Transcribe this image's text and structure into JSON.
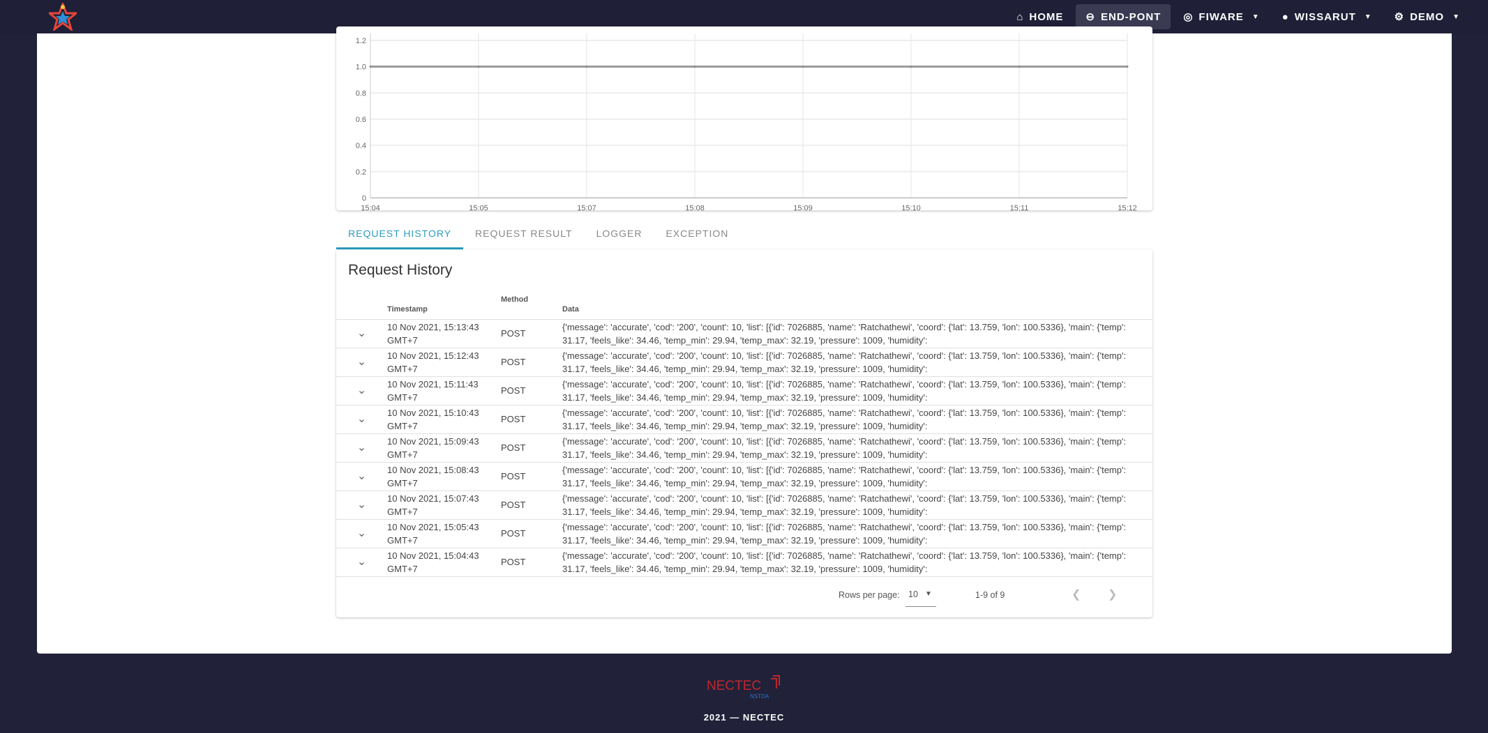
{
  "nav": {
    "items": [
      {
        "label": "HOME",
        "icon": "home-icon"
      },
      {
        "label": "END-PONT",
        "icon": "link-icon",
        "active": true
      },
      {
        "label": "FIWARE",
        "icon": "fingerprint-icon",
        "dropdown": true
      },
      {
        "label": "WISSARUT",
        "icon": "user-icon",
        "dropdown": true
      },
      {
        "label": "DEMO",
        "icon": "gears-icon",
        "dropdown": true
      }
    ]
  },
  "chart_data": {
    "type": "line",
    "x": [
      "15:04",
      "15:05",
      "15:07",
      "15:08",
      "15:09",
      "15:10",
      "15:11",
      "15:12"
    ],
    "series": [
      {
        "values": [
          1,
          1,
          1,
          1,
          1,
          1,
          1,
          1
        ]
      }
    ],
    "yticks": [
      "0",
      "0.2",
      "0.4",
      "0.6",
      "0.8",
      "1.0",
      "1.2"
    ],
    "ylim": [
      0,
      1.2
    ],
    "grid": true
  },
  "tabs": [
    {
      "label": "REQUEST HISTORY",
      "active": true
    },
    {
      "label": "REQUEST RESULT"
    },
    {
      "label": "LOGGER"
    },
    {
      "label": "EXCEPTION"
    }
  ],
  "table": {
    "title": "Request History",
    "headers": [
      "Timestamp",
      "Method",
      "Data"
    ],
    "rows": [
      {
        "ts": "10 Nov 2021, 15:13:43 GMT+7",
        "method": "POST"
      },
      {
        "ts": "10 Nov 2021, 15:12:43 GMT+7",
        "method": "POST"
      },
      {
        "ts": "10 Nov 2021, 15:11:43 GMT+7",
        "method": "POST"
      },
      {
        "ts": "10 Nov 2021, 15:10:43 GMT+7",
        "method": "POST"
      },
      {
        "ts": "10 Nov 2021, 15:09:43 GMT+7",
        "method": "POST"
      },
      {
        "ts": "10 Nov 2021, 15:08:43 GMT+7",
        "method": "POST"
      },
      {
        "ts": "10 Nov 2021, 15:07:43 GMT+7",
        "method": "POST"
      },
      {
        "ts": "10 Nov 2021, 15:05:43 GMT+7",
        "method": "POST"
      },
      {
        "ts": "10 Nov 2021, 15:04:43 GMT+7",
        "method": "POST"
      }
    ],
    "data_text": "{'message': 'accurate', 'cod': '200', 'count': 10, 'list': [{'id': 7026885, 'name': 'Ratchathewi', 'coord': {'lat': 13.759, 'lon': 100.5336}, 'main': {'temp': 31.17, 'feels_like': 34.46, 'temp_min': 29.94, 'temp_max': 32.19, 'pressure': 1009, 'humidity':"
  },
  "pager": {
    "rows_label": "Rows per page:",
    "rows_value": "10",
    "range": "1-9 of 9"
  },
  "footer": {
    "logo": "NECTEC",
    "logo_sub": "NSTDA",
    "text": "2021 — NECTEC"
  },
  "colors": {
    "nav_bg": "#1f2037",
    "accent": "#2a9bbf"
  }
}
